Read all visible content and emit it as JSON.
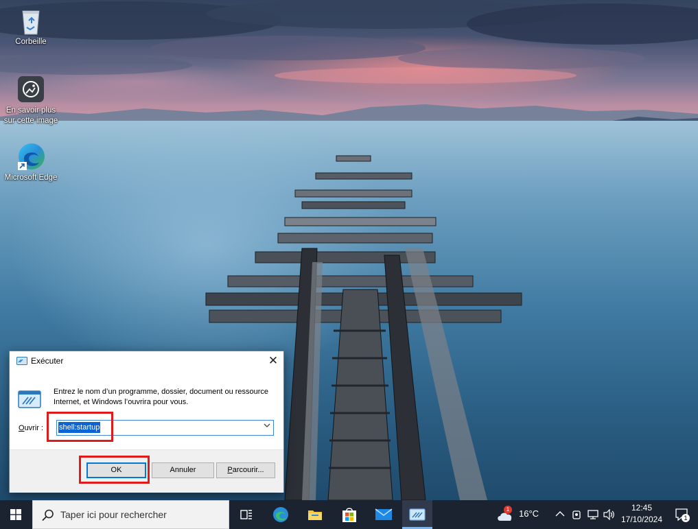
{
  "desktop": {
    "icons": [
      {
        "label": "Corbeille",
        "icon": "recycle-bin-icon"
      },
      {
        "label_line1": "En savoir plus",
        "label_line2": "sur cette image",
        "icon": "camera-info-icon"
      },
      {
        "label": "Microsoft Edge",
        "icon": "edge-icon"
      }
    ]
  },
  "run_dialog": {
    "title": "Exécuter",
    "description": "Entrez le nom d’un programme, dossier, document ou ressource Internet, et Windows l’ouvrira pour vous.",
    "open_label_prefix": "O",
    "open_label_rest": "uvrir :",
    "open_value": "shell:startup",
    "buttons": {
      "ok": "OK",
      "cancel": "Annuler",
      "browse_prefix": "P",
      "browse_rest": "arcourir..."
    }
  },
  "taskbar": {
    "search_placeholder": "Taper ici pour rechercher",
    "weather": {
      "temperature": "16°C",
      "badge": "1"
    },
    "clock": {
      "time": "12:45",
      "date": "17/10/2024"
    },
    "notification_count": "1",
    "apps": [
      "task-view-icon",
      "edge-icon",
      "file-explorer-icon",
      "store-icon",
      "mail-icon",
      "run-icon"
    ]
  },
  "colors": {
    "highlight": "#e01919",
    "selection": "#0a64d6",
    "taskbar": "#1b2230"
  }
}
